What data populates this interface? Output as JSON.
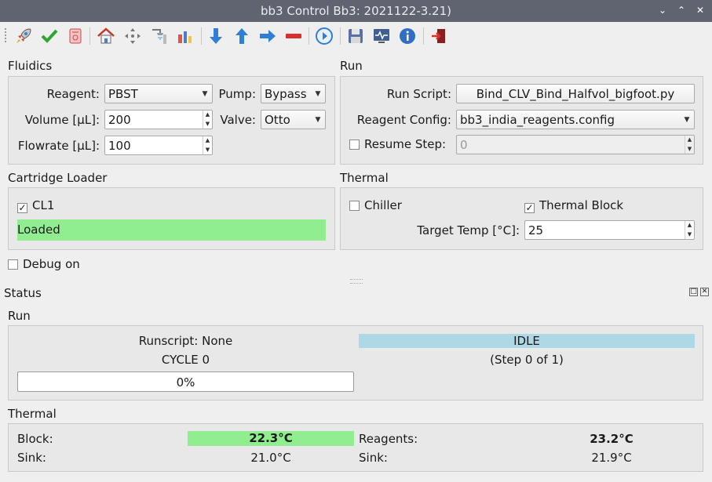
{
  "window": {
    "title": "bb3 Control Bb3: 2021122-3.21)"
  },
  "toolbar": {
    "icons": [
      "rocket-icon",
      "checkmark-icon",
      "reset-icon",
      "home-icon",
      "move-icon",
      "shower-icon",
      "pipette-icon",
      "arrow-down-icon",
      "arrow-up-icon",
      "arrow-right-icon",
      "remove-icon",
      "play-icon",
      "save-icon",
      "monitor-icon",
      "info-icon",
      "exit-icon"
    ]
  },
  "fluidics": {
    "title": "Fluidics",
    "reagent_label": "Reagent:",
    "reagent_value": "PBST",
    "pump_label": "Pump:",
    "pump_value": "Bypass",
    "volume_label": "Volume [µL]:",
    "volume_value": "200",
    "valve_label": "Valve:",
    "valve_value": "Otto",
    "flowrate_label": "Flowrate [µL]:",
    "flowrate_value": "100"
  },
  "run": {
    "title": "Run",
    "script_label": "Run Script:",
    "script_value": "Bind_CLV_Bind_Halfvol_bigfoot.py",
    "config_label": "Reagent Config:",
    "config_value": "bb3_india_reagents.config",
    "resume_label": "Resume Step:",
    "resume_value": "0"
  },
  "cartridge": {
    "title": "Cartridge Loader",
    "cl1_label": "CL1",
    "cl1_checked": "✓",
    "status": "Loaded",
    "status_color": "#90ee90"
  },
  "thermal": {
    "title": "Thermal",
    "chiller_label": "Chiller",
    "block_label": "Thermal Block",
    "block_checked": "✓",
    "target_label": "Target Temp [°C]:",
    "target_value": "25"
  },
  "debug": {
    "label": "Debug on"
  },
  "status": {
    "title": "Status",
    "run_title": "Run",
    "runscript": "Runscript: None",
    "cycle": "CYCLE 0",
    "progress_text": "0%",
    "progress": 0,
    "state": "IDLE",
    "state_color": "#add8e6",
    "step": "(Step 0 of 1)",
    "thermal_title": "Thermal",
    "block_label": "Block:",
    "block_value": "22.3°C",
    "block_color": "#90ee90",
    "sink1_label": "Sink:",
    "sink1_value": "21.0°C",
    "reagents_label": "Reagents:",
    "reagents_value": "23.2°C",
    "sink2_label": "Sink:",
    "sink2_value": "21.9°C"
  }
}
